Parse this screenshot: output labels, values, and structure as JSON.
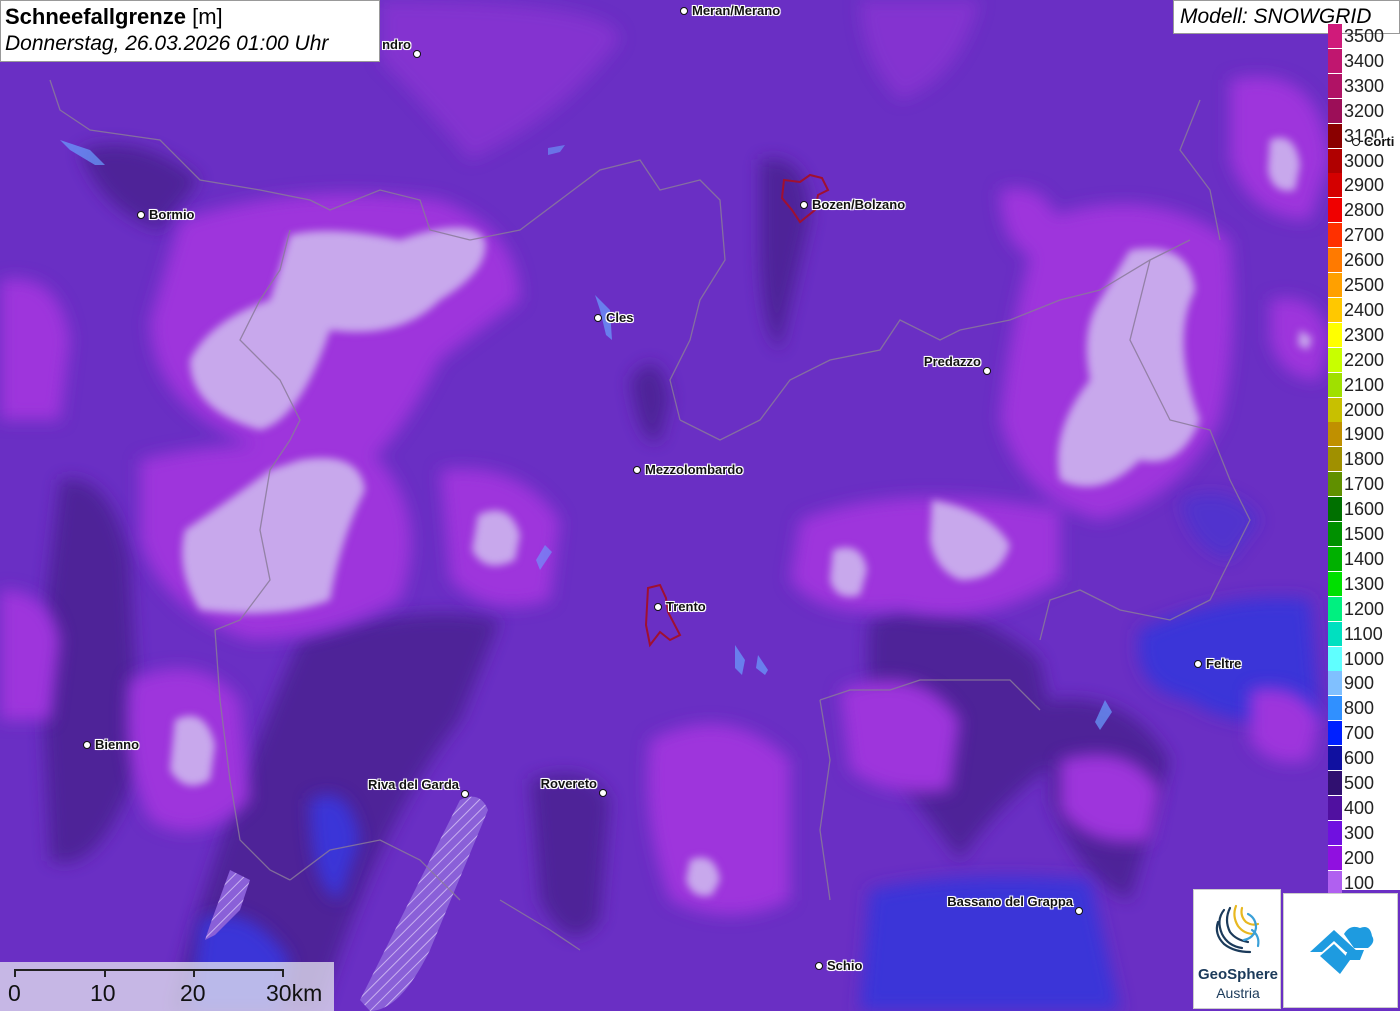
{
  "title": {
    "main": "Schneefallgrenze",
    "unit": "[m]",
    "datetime": "Donnerstag, 26.03.2026 01:00 Uhr"
  },
  "model": {
    "label": "Modell: SNOWGRID"
  },
  "legend": [
    {
      "label": "3500",
      "color": "#d01a7a"
    },
    {
      "label": "3400",
      "color": "#c0166f"
    },
    {
      "label": "3300",
      "color": "#b01265"
    },
    {
      "label": "3200",
      "color": "#9c0e58"
    },
    {
      "label": "3100",
      "color": "#8a0000"
    },
    {
      "label": "3000",
      "color": "#b00000"
    },
    {
      "label": "2900",
      "color": "#d40000"
    },
    {
      "label": "2800",
      "color": "#f00000"
    },
    {
      "label": "2700",
      "color": "#ff3000"
    },
    {
      "label": "2600",
      "color": "#ff7a00"
    },
    {
      "label": "2500",
      "color": "#ffa000"
    },
    {
      "label": "2400",
      "color": "#ffc800"
    },
    {
      "label": "2300",
      "color": "#ffff00"
    },
    {
      "label": "2200",
      "color": "#c8ff00"
    },
    {
      "label": "2100",
      "color": "#a0e000"
    },
    {
      "label": "2000",
      "color": "#c8c000"
    },
    {
      "label": "1900",
      "color": "#c09000"
    },
    {
      "label": "1800",
      "color": "#a09000"
    },
    {
      "label": "1700",
      "color": "#609000"
    },
    {
      "label": "1600",
      "color": "#007000"
    },
    {
      "label": "1500",
      "color": "#009000"
    },
    {
      "label": "1400",
      "color": "#00b000"
    },
    {
      "label": "1300",
      "color": "#00e000"
    },
    {
      "label": "1200",
      "color": "#00f080"
    },
    {
      "label": "1100",
      "color": "#00e0c0"
    },
    {
      "label": "1000",
      "color": "#60ffff"
    },
    {
      "label": "900",
      "color": "#80c0ff"
    },
    {
      "label": "800",
      "color": "#3090ff"
    },
    {
      "label": "700",
      "color": "#0020ff"
    },
    {
      "label": "600",
      "color": "#1010a0"
    },
    {
      "label": "500",
      "color": "#301070"
    },
    {
      "label": "400",
      "color": "#5010a0"
    },
    {
      "label": "300",
      "color": "#7010e0"
    },
    {
      "label": "200",
      "color": "#9010e0"
    },
    {
      "label": "100",
      "color": "#b060f0"
    }
  ],
  "cities": [
    {
      "name": "Meran/Merano",
      "side": "right"
    },
    {
      "name": "ndro",
      "side": "left"
    },
    {
      "name": "Bormio",
      "side": "right"
    },
    {
      "name": "Bozen/Bolzano",
      "side": "right"
    },
    {
      "name": "Cles",
      "side": "right"
    },
    {
      "name": "Predazzo",
      "side": "left"
    },
    {
      "name": "Mezzolombardo",
      "side": "right"
    },
    {
      "name": "Trento",
      "side": "right"
    },
    {
      "name": "Feltre",
      "side": "right"
    },
    {
      "name": "Bienno",
      "side": "right"
    },
    {
      "name": "Riva del Garda",
      "side": "left"
    },
    {
      "name": "Rovereto",
      "side": "left"
    },
    {
      "name": "Bassano del Grappa",
      "side": "left"
    },
    {
      "name": "Schio",
      "side": "right"
    },
    {
      "name": "Corti",
      "side": "right"
    }
  ],
  "scale": {
    "labels": [
      "0",
      "10",
      "20",
      "30km"
    ]
  },
  "logos": {
    "geosphere_line1": "GeoSphere",
    "geosphere_line2": "Austria"
  },
  "colors": {
    "base": "#6a2fc4",
    "light": "#c9a8e8",
    "mid": "#8c3ae6",
    "magenta": "#a83ad8",
    "dark": "#4a2590",
    "blue": "#3a3ae0"
  },
  "icons": [
    "geosphere-logo-icon",
    "app-logo-icon"
  ]
}
